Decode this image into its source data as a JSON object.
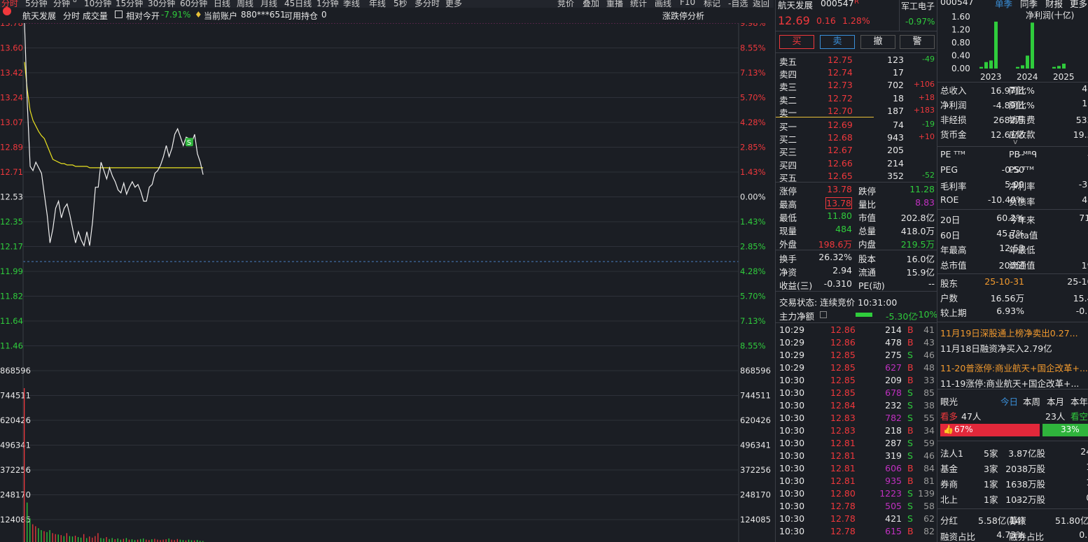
{
  "toolbar": {
    "periods": [
      "分时",
      "5分钟",
      "分钟",
      "10分钟",
      "15分钟",
      "30分钟",
      "60分钟",
      "日线",
      "周线",
      "月线",
      "45日线",
      "1分钟",
      "季线",
      "年线",
      "5秒",
      "多分时",
      "更多"
    ],
    "badge": "8",
    "right_items": [
      "竞价",
      "叠加",
      "重播",
      "统计",
      "画线",
      "F10",
      "标记",
      "-自选",
      "返回"
    ]
  },
  "header": {
    "stock_name": "航天发展",
    "mode": "分时 成交量",
    "relative_label": "相对今开",
    "relative_value": "-7.91%",
    "account_label": "当前账户",
    "account_value": "880***651",
    "position_label": "可用持仓",
    "position_value": "0",
    "analysis_link": "涨跌停分析"
  },
  "price_axis": {
    "left": [
      "13.78",
      "13.60",
      "13.42",
      "13.24",
      "13.07",
      "12.89",
      "12.71",
      "12.53",
      "12.35",
      "12.17",
      "11.99",
      "11.82",
      "11.64",
      "11.46"
    ],
    "right": [
      "9.98%",
      "8.55%",
      "7.13%",
      "5.70%",
      "4.28%",
      "2.85%",
      "1.43%",
      "0.00%",
      "1.43%",
      "2.85%",
      "4.28%",
      "5.70%",
      "7.13%",
      "8.55%"
    ]
  },
  "volume_axis": {
    "left": [
      "868596",
      "744511",
      "620426",
      "496341",
      "372256",
      "248170",
      "124085"
    ],
    "right": [
      "868596",
      "744511",
      "620426",
      "496341",
      "372256",
      "248170",
      "124085"
    ]
  },
  "chart_data": {
    "type": "line",
    "title": "航天发展 分时",
    "ylim": [
      11.28,
      13.78
    ],
    "prev_close": 12.53,
    "series": [
      {
        "name": "price",
        "values": [
          13.78,
          13.2,
          12.75,
          12.72,
          12.78,
          12.74,
          12.7,
          12.55,
          12.4,
          12.2,
          12.3,
          12.45,
          12.5,
          12.38,
          12.45,
          12.48,
          12.4,
          12.3,
          12.2,
          12.28,
          12.22,
          12.18,
          12.28,
          12.18,
          12.35,
          12.6,
          12.6,
          12.78,
          12.72,
          12.66,
          12.74,
          12.68,
          12.64,
          12.58,
          12.56,
          12.63,
          12.55,
          12.6,
          12.64,
          12.6,
          12.62,
          12.57,
          12.5,
          12.5,
          12.6,
          12.62,
          12.7,
          12.72,
          12.76,
          12.82,
          12.9,
          12.82,
          12.88,
          12.98,
          13.02,
          12.96,
          12.9,
          12.96,
          12.95,
          12.92,
          12.98,
          12.84,
          12.78,
          12.69
        ]
      },
      {
        "name": "avg",
        "values": [
          13.5,
          13.3,
          13.15,
          13.08,
          13.04,
          13.0,
          12.97,
          12.95,
          12.9,
          12.85,
          12.8,
          12.79,
          12.78,
          12.77,
          12.77,
          12.76,
          12.76,
          12.76,
          12.75,
          12.75,
          12.75,
          12.75,
          12.75,
          12.74,
          12.74,
          12.74,
          12.74,
          12.74,
          12.74,
          12.74,
          12.74,
          12.74,
          12.74,
          12.74,
          12.74,
          12.74,
          12.74,
          12.74,
          12.74,
          12.74,
          12.74,
          12.74,
          12.74,
          12.74,
          12.74,
          12.74,
          12.74,
          12.74,
          12.74,
          12.74,
          12.74,
          12.74,
          12.74,
          12.74,
          12.74,
          12.74,
          12.74,
          12.74,
          12.74,
          12.74,
          12.74,
          12.74,
          12.74,
          12.74
        ]
      }
    ],
    "volume_ylim": [
      0,
      868596
    ],
    "volume": [
      780000,
      200000,
      120000,
      90000,
      80000,
      70000,
      60000,
      55000,
      50000,
      60000,
      45000,
      40000,
      38000,
      35000,
      30000,
      45000,
      30000,
      28000,
      32000,
      25000,
      22000,
      40000,
      20000,
      28000,
      22000,
      30000,
      45000,
      20000,
      18000,
      25000,
      15000,
      20000,
      14000,
      18000,
      12000,
      16000,
      20000,
      12000,
      14000,
      10000,
      12000,
      15000,
      18000,
      12000,
      10000,
      14000,
      16000,
      12000,
      10000,
      12000,
      14000,
      18000,
      12000,
      10000,
      15000,
      12000,
      10000,
      8000,
      12000,
      9000,
      8000,
      10000,
      6000,
      5000
    ],
    "volume_colors": [
      "red",
      "green",
      "green",
      "red",
      "red",
      "green",
      "green",
      "red",
      "green",
      "green",
      "red",
      "red",
      "green",
      "red",
      "green",
      "red",
      "green",
      "green",
      "red",
      "green",
      "green",
      "red",
      "green",
      "red",
      "red",
      "red",
      "red",
      "green",
      "green",
      "red",
      "green",
      "green",
      "red",
      "green",
      "green",
      "red",
      "green",
      "red",
      "green",
      "green",
      "red",
      "green",
      "green",
      "red",
      "red",
      "green",
      "red",
      "red",
      "red",
      "red",
      "red",
      "green",
      "red",
      "red",
      "red",
      "green",
      "green",
      "red",
      "green",
      "green",
      "red",
      "green",
      "green",
      "green"
    ],
    "marker": "S"
  },
  "quote": {
    "name": "航天发展",
    "code": "000547",
    "flag": "R",
    "sector": "军工电子",
    "sector_change": "-0.97%",
    "price": "12.69",
    "change": "0.16",
    "change_pct": "1.28%",
    "buttons": [
      "买",
      "卖",
      "撤",
      "警"
    ],
    "asks": [
      {
        "label": "卖五",
        "price": "12.75",
        "vol": "123",
        "delta": "-49"
      },
      {
        "label": "卖四",
        "price": "12.74",
        "vol": "17",
        "delta": ""
      },
      {
        "label": "卖三",
        "price": "12.73",
        "vol": "702",
        "delta": "+106"
      },
      {
        "label": "卖二",
        "price": "12.72",
        "vol": "18",
        "delta": "+18"
      },
      {
        "label": "卖一",
        "price": "12.70",
        "vol": "187",
        "delta": "+183"
      }
    ],
    "bids": [
      {
        "label": "买一",
        "price": "12.69",
        "vol": "74",
        "delta": "-19"
      },
      {
        "label": "买二",
        "price": "12.68",
        "vol": "943",
        "delta": "+10"
      },
      {
        "label": "买三",
        "price": "12.67",
        "vol": "205",
        "delta": ""
      },
      {
        "label": "买四",
        "price": "12.66",
        "vol": "214",
        "delta": ""
      },
      {
        "label": "买五",
        "price": "12.65",
        "vol": "352",
        "delta": "-52"
      }
    ],
    "stats": [
      {
        "l1": "涨停",
        "v1": "13.78",
        "l2": "跌停",
        "v2": "11.28"
      },
      {
        "l1": "最高",
        "v1": "13.78",
        "l2": "量比",
        "v2": "8.83"
      },
      {
        "l1": "最低",
        "v1": "11.80",
        "l2": "市值",
        "v2": "202.8亿"
      },
      {
        "l1": "现量",
        "v1": "484",
        "l2": "总量",
        "v2": "418.0万"
      },
      {
        "l1": "外盘",
        "v1": "198.6万",
        "l2": "内盘",
        "v2": "219.5万"
      }
    ],
    "stats2": [
      {
        "l1": "换手",
        "v1": "26.32%",
        "l2": "股本",
        "v2": "16.0亿"
      },
      {
        "l1": "净资",
        "v1": "2.94",
        "l2": "流通",
        "v2": "15.9亿"
      },
      {
        "l1": "收益(三)",
        "v1": "-0.310",
        "l2": "PE(动)",
        "v2": "--"
      }
    ],
    "trade_status": "交易状态: 连续竞价 10:31:00",
    "main_flow_label": "主力净额",
    "main_flow_value": "-5.30亿",
    "main_flow_pct": "-10%",
    "ticks": [
      {
        "t": "10:29",
        "p": "12.86",
        "v": "214",
        "s": "B",
        "n": "41",
        "big": false
      },
      {
        "t": "10:29",
        "p": "12.86",
        "v": "478",
        "s": "B",
        "n": "43",
        "big": false
      },
      {
        "t": "10:29",
        "p": "12.85",
        "v": "275",
        "s": "S",
        "n": "46",
        "big": false
      },
      {
        "t": "10:29",
        "p": "12.85",
        "v": "627",
        "s": "B",
        "n": "48",
        "big": true
      },
      {
        "t": "10:30",
        "p": "12.85",
        "v": "209",
        "s": "B",
        "n": "33",
        "big": false
      },
      {
        "t": "10:30",
        "p": "12.85",
        "v": "678",
        "s": "S",
        "n": "85",
        "big": true
      },
      {
        "t": "10:30",
        "p": "12.84",
        "v": "232",
        "s": "S",
        "n": "38",
        "big": false
      },
      {
        "t": "10:30",
        "p": "12.83",
        "v": "782",
        "s": "S",
        "n": "55",
        "big": true
      },
      {
        "t": "10:30",
        "p": "12.83",
        "v": "218",
        "s": "B",
        "n": "34",
        "big": false
      },
      {
        "t": "10:30",
        "p": "12.81",
        "v": "287",
        "s": "S",
        "n": "59",
        "big": false
      },
      {
        "t": "10:30",
        "p": "12.81",
        "v": "319",
        "s": "S",
        "n": "46",
        "big": false
      },
      {
        "t": "10:30",
        "p": "12.81",
        "v": "606",
        "s": "B",
        "n": "84",
        "big": true
      },
      {
        "t": "10:30",
        "p": "12.81",
        "v": "935",
        "s": "B",
        "n": "81",
        "big": true
      },
      {
        "t": "10:30",
        "p": "12.80",
        "v": "1223",
        "s": "S",
        "n": "139",
        "big": true
      },
      {
        "t": "10:30",
        "p": "12.78",
        "v": "505",
        "s": "S",
        "n": "58",
        "big": true
      },
      {
        "t": "10:30",
        "p": "12.78",
        "v": "421",
        "s": "S",
        "n": "62",
        "big": false
      },
      {
        "t": "10:30",
        "p": "12.78",
        "v": "615",
        "s": "B",
        "n": "82",
        "big": true
      }
    ]
  },
  "fundamentals": {
    "code": "000547",
    "tabs": [
      "单季",
      "同季",
      "财报",
      "更多"
    ],
    "bar_title": "净利润(十亿)",
    "bar_yaxis": [
      "1.60",
      "1.20",
      "0.80",
      "0.40",
      "0.00"
    ],
    "bar_years": [
      "2023",
      "2024",
      "2025"
    ],
    "bar_values": [
      0.05,
      0.2,
      0.25,
      1.45,
      0.05,
      0.1,
      0.4,
      1.42,
      0.05,
      0.08,
      0.15
    ],
    "rows": [
      {
        "l1": "总收入",
        "v1": "16.97亿",
        "l2": "同比%",
        "v2": "42.59"
      },
      {
        "l1": "净利润",
        "v1": "-4.89亿",
        "l2": "同比%",
        "v2": "12.38"
      },
      {
        "l1": "非经损",
        "v1": "2682万",
        "l2": "销售费",
        "v2": "5333万"
      },
      {
        "l1": "货币金",
        "v1": "12.61亿",
        "l2": "应收款",
        "v2": "19.52亿"
      }
    ],
    "ratios": [
      {
        "l1": "PE ᵀᵀᴹ",
        "v1": "--",
        "l2": "PB ᴹᴿᑫ",
        "v2": "4.26"
      },
      {
        "l1": "PEG",
        "v1": "-0.50",
        "l2": "PS ᵀᵀᴹ",
        "v2": "8.43"
      },
      {
        "l1": "毛利率",
        "v1": "5.09",
        "l2": "净利率",
        "v2": "-32.27"
      },
      {
        "l1": "ROE",
        "v1": "-10.40%",
        "l2": "负债率",
        "v2": "46.34"
      }
    ],
    "perf": [
      {
        "l1": "20日",
        "v1": "60.2%",
        "l2": "今年来",
        "v2": "71.4%"
      },
      {
        "l1": "60日",
        "v1": "45.7%",
        "l2": "Beta值",
        "v2": "0.10"
      },
      {
        "l1": "年最高",
        "v1": "12.53",
        "l2": "年最低",
        "v2": "6.42"
      },
      {
        "l1": "总市值",
        "v1": "200亿",
        "l2": "流通值",
        "v2": "199亿"
      }
    ],
    "holders": [
      {
        "l1": "股东",
        "v1": "25-10-31",
        "v2": "25-10-20"
      },
      {
        "l1": "户数",
        "v1": "16.56万",
        "v2": "15.49万"
      },
      {
        "l1": "较上期",
        "v1": "6.93%",
        "v2": "-0.68%"
      }
    ],
    "news": [
      {
        "text": "11月19日深股通上榜净卖出0.27...",
        "color": "orange"
      },
      {
        "text": "11月18日融资净买入2.79亿",
        "color": "white"
      },
      {
        "text": "11-20普涨停:商业航天+国企改革+...",
        "color": "orange"
      },
      {
        "text": "11-19涨停:商业航天+国企改革+...",
        "color": "white"
      }
    ],
    "vision": {
      "label": "眼光",
      "tabs": [
        "今日",
        "本周",
        "本月",
        "本年"
      ],
      "bull_label": "看多",
      "bull_count": "47人",
      "bear_count": "23人",
      "bear_label": "看空",
      "bull_pct": "67%",
      "bear_pct": "33%"
    },
    "institutions": [
      {
        "name": "法人1",
        "count": "5家",
        "shares": "3.87亿股",
        "pct": "24.4%"
      },
      {
        "name": "基金",
        "count": "3家",
        "shares": "2038万股",
        "pct": "1.3%"
      },
      {
        "name": "券商",
        "count": "1家",
        "shares": "1638万股",
        "pct": "1.0%"
      },
      {
        "name": "北上",
        "count": "1家",
        "shares": "1032万股",
        "pct": "0.7%"
      }
    ],
    "bottom": [
      {
        "l1": "分红",
        "v1": "5.58亿(14)",
        "l2": "募资",
        "v2": "51.80亿(10)"
      },
      {
        "l1": "融资占比",
        "v1": "4.73%",
        "l2": "融券占比",
        "v2": "0.01%"
      }
    ]
  }
}
